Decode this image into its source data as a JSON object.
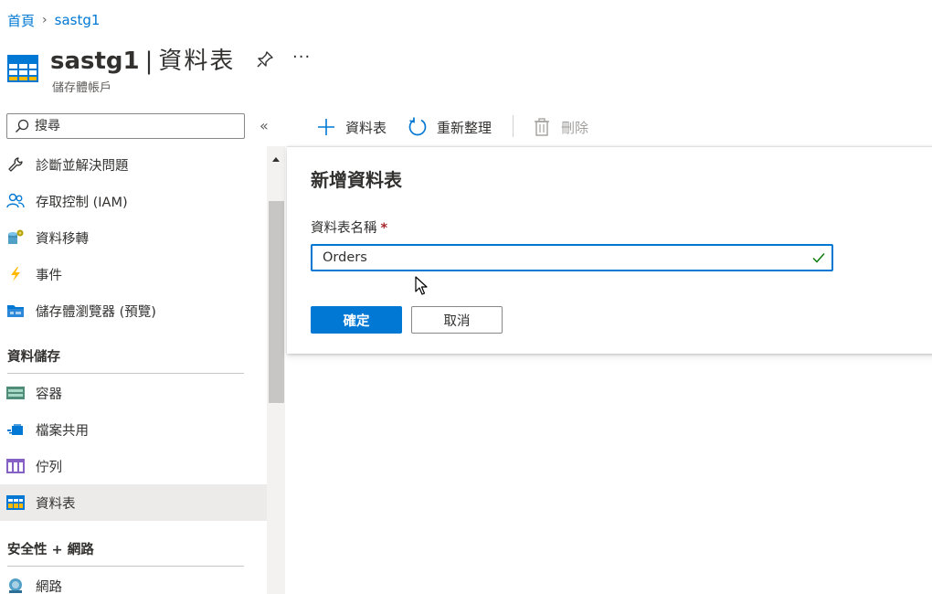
{
  "breadcrumb": {
    "home": "首頁",
    "separator": "›",
    "resource": "sastg1"
  },
  "header": {
    "resource_name": "sastg1",
    "separator": "|",
    "page_title": "資料表",
    "subtitle": "儲存體帳戶",
    "more_label": "···",
    "icon": "table-icon"
  },
  "sidebar": {
    "search_placeholder": "搜尋",
    "collapse_label": "«",
    "items": [
      {
        "label": "診斷並解決問題",
        "icon": "wrench-icon"
      },
      {
        "label": "存取控制 (IAM)",
        "icon": "people-icon"
      },
      {
        "label": "資料移轉",
        "icon": "data-migration-icon"
      },
      {
        "label": "事件",
        "icon": "lightning-icon"
      },
      {
        "label": "儲存體瀏覽器 (預覽)",
        "icon": "storage-explorer-icon"
      }
    ],
    "groups": [
      {
        "title": "資料儲存",
        "items": [
          {
            "label": "容器",
            "icon": "container-icon"
          },
          {
            "label": "檔案共用",
            "icon": "file-share-icon"
          },
          {
            "label": "佇列",
            "icon": "queue-icon"
          },
          {
            "label": "資料表",
            "icon": "table-icon",
            "selected": true
          }
        ]
      },
      {
        "title": "安全性 + 網路",
        "items": [
          {
            "label": "網路",
            "icon": "network-icon"
          }
        ]
      }
    ]
  },
  "toolbar": {
    "add_label": "資料表",
    "refresh_label": "重新整理",
    "delete_label": "刪除",
    "delete_disabled": true
  },
  "dialog": {
    "title": "新增資料表",
    "field_label": "資料表名稱",
    "required_mark": "*",
    "field_value": "Orders",
    "ok_label": "確定",
    "cancel_label": "取消"
  },
  "colors": {
    "accent": "#0078d4",
    "required": "#a4262c",
    "valid": "#107c10",
    "selected_bg": "#edebe9"
  }
}
